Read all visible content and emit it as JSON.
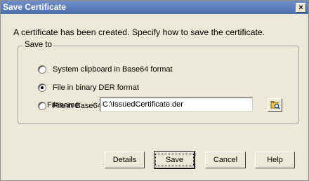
{
  "window": {
    "title": "Save Certificate",
    "close_label": "×"
  },
  "message": "A certificate has been created.  Specify how to save the certificate.",
  "group": {
    "label": "Save to",
    "options": [
      {
        "label": "System clipboard in Base64 format",
        "checked": false
      },
      {
        "label": "File in binary DER format",
        "checked": true
      },
      {
        "label": "File in Base64 format",
        "checked": false
      }
    ]
  },
  "filename": {
    "label": "Filename:",
    "value": "C:\\IssuedCertificate.der",
    "browse_icon": "folder-browse-icon"
  },
  "buttons": {
    "details": "Details",
    "save": "Save",
    "cancel": "Cancel",
    "help": "Help"
  }
}
